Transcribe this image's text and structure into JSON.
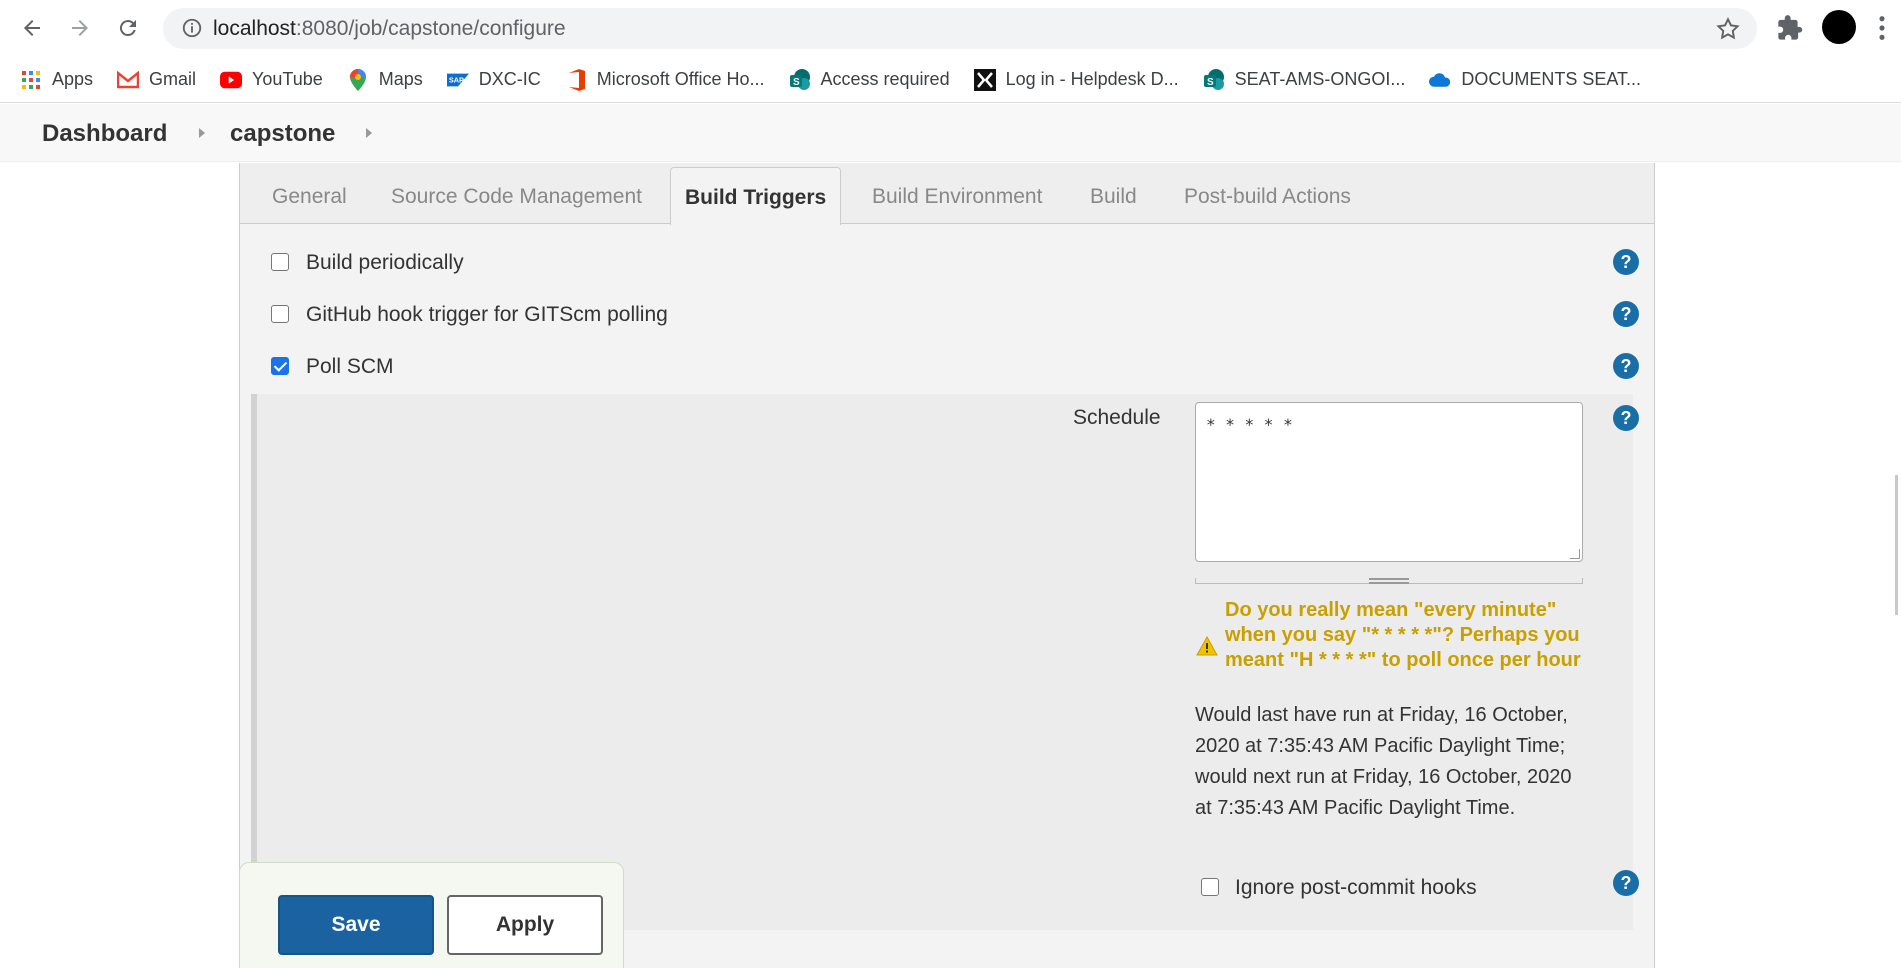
{
  "browser": {
    "url_host": "localhost",
    "url_path": ":8080/job/capstone/configure",
    "bookmarks": [
      {
        "label": "Apps",
        "icon": "apps-grid-icon"
      },
      {
        "label": "Gmail",
        "icon": "gmail-icon"
      },
      {
        "label": "YouTube",
        "icon": "youtube-icon"
      },
      {
        "label": "Maps",
        "icon": "maps-icon"
      },
      {
        "label": "DXC-IC",
        "icon": "sap-icon"
      },
      {
        "label": "Microsoft Office Ho...",
        "icon": "office-icon"
      },
      {
        "label": "Access required",
        "icon": "sharepoint-icon"
      },
      {
        "label": "Log in - Helpdesk D...",
        "icon": "helpdesk-icon"
      },
      {
        "label": "SEAT-AMS-ONGOI...",
        "icon": "sharepoint-icon"
      },
      {
        "label": "DOCUMENTS SEAT...",
        "icon": "onedrive-icon"
      }
    ]
  },
  "breadcrumb": {
    "dashboard": "Dashboard",
    "job": "capstone"
  },
  "tabs": [
    {
      "label": "General",
      "active": false
    },
    {
      "label": "Source Code Management",
      "active": false
    },
    {
      "label": "Build Triggers",
      "active": true
    },
    {
      "label": "Build Environment",
      "active": false
    },
    {
      "label": "Build",
      "active": false
    },
    {
      "label": "Post-build Actions",
      "active": false
    }
  ],
  "triggers": {
    "build_periodically": "Build periodically",
    "github_hook": "GitHub hook trigger for GITScm polling",
    "poll_scm": "Poll SCM",
    "schedule_label": "Schedule",
    "schedule_value": "* * * * *",
    "warning": "Do you really mean \"every minute\" when you say \"* * * * *\"? Perhaps you meant \"H * * * *\" to poll once per hour",
    "info": "Would last have run at Friday, 16 October, 2020 at 7:35:43 AM Pacific Daylight Time; would next run at Friday, 16 October, 2020 at 7:35:43 AM Pacific Daylight Time.",
    "ignore_hooks": "Ignore post-commit hooks"
  },
  "actions": {
    "save": "Save",
    "apply": "Apply"
  },
  "colors": {
    "warning": "#c8a000",
    "help": "#1a6ea8",
    "save_button": "#1b63a0",
    "checkbox_checked": "#1a73e8"
  }
}
